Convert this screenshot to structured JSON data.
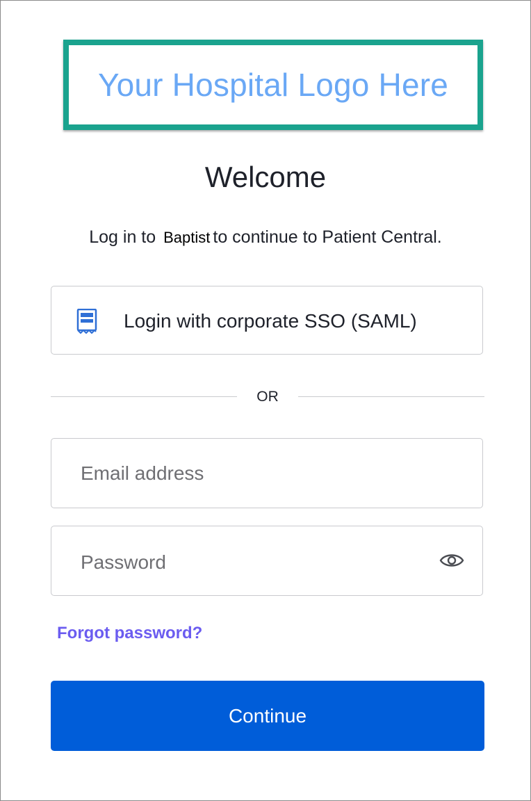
{
  "logo": {
    "text": "Your Hospital Logo Here"
  },
  "header": {
    "title": "Welcome",
    "subtitle_prefix": "Log in to",
    "organization": "Baptist",
    "subtitle_suffix": "to continue to Patient Central."
  },
  "sso": {
    "label": "Login with corporate SSO (SAML)",
    "icon": "receipt-icon"
  },
  "divider": {
    "text": "OR"
  },
  "email": {
    "placeholder": "Email address",
    "value": ""
  },
  "password": {
    "placeholder": "Password",
    "value": "",
    "toggle_icon": "eye-icon"
  },
  "links": {
    "forgot_password": "Forgot password?"
  },
  "actions": {
    "continue_label": "Continue"
  },
  "colors": {
    "logo_border": "#1aa38e",
    "logo_text": "#6aa8f5",
    "primary_button": "#005dd9",
    "link": "#6b5cf0"
  }
}
